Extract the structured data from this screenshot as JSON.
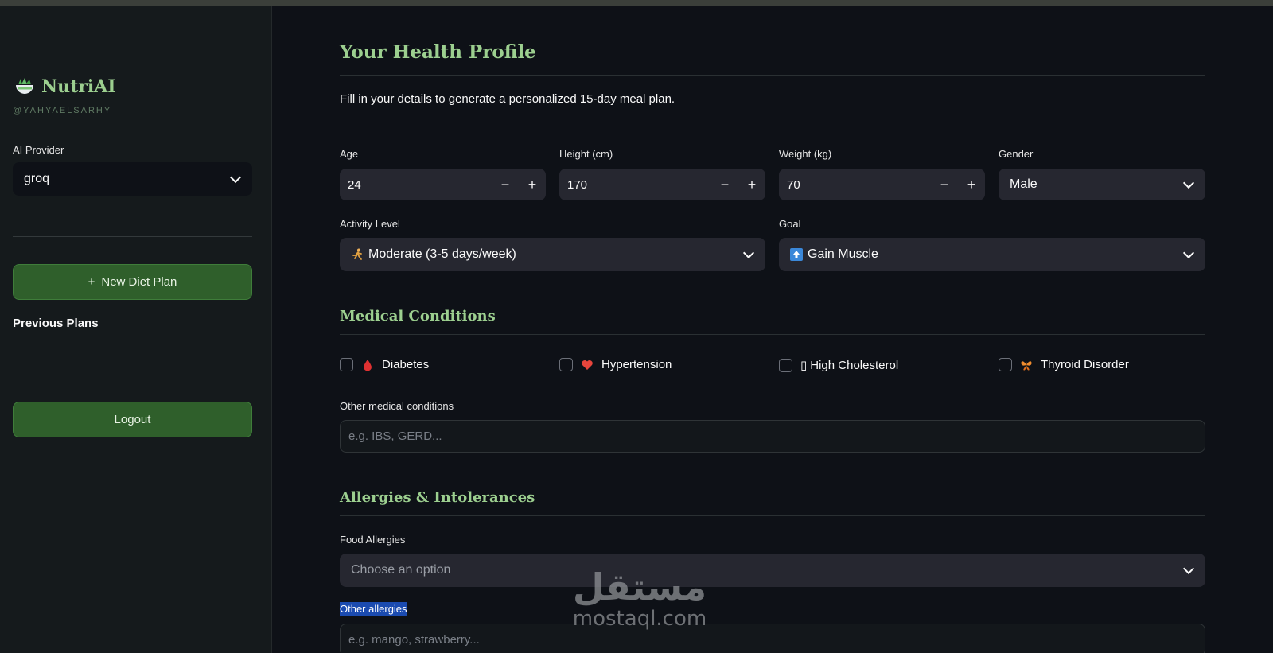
{
  "sidebar": {
    "brand": "NutriAI",
    "handle": "@YAHYAELSARHY",
    "provider_label": "AI Provider",
    "provider_value": "groq",
    "new_plan": "New Diet Plan",
    "new_plan_icon": "+",
    "previous_plans": "Previous Plans",
    "logout": "Logout"
  },
  "profile": {
    "title": "Your Health Profile",
    "intro": "Fill in your details to generate a personalized 15-day meal plan.",
    "age_label": "Age",
    "age_value": "24",
    "height_label": "Height (cm)",
    "height_value": "170",
    "weight_label": "Weight (kg)",
    "weight_value": "70",
    "gender_label": "Gender",
    "gender_value": "Male",
    "activity_label": "Activity Level",
    "activity_value": "Moderate (3-5 days/week)",
    "goal_label": "Goal",
    "goal_value": "Gain Muscle",
    "minus": "−",
    "plus": "+"
  },
  "medical": {
    "title": "Medical Conditions",
    "conditions": [
      "Diabetes",
      "Hypertension",
      "High Cholesterol",
      "Thyroid Disorder"
    ],
    "cholesterol_glyph": "▯",
    "other_label": "Other medical conditions",
    "other_placeholder": "e.g. IBS, GERD..."
  },
  "allergies": {
    "title": "Allergies & Intolerances",
    "food_label": "Food Allergies",
    "food_placeholder": "Choose an option",
    "other_label": "Other allergies",
    "other_placeholder": "e.g. mango, strawberry..."
  },
  "watermark": {
    "arabic": "مستقل",
    "latin": "mostaql.com"
  },
  "colors": {
    "accent": "#9ccf8f",
    "button": "#2f5f2b",
    "background": "#0e1117",
    "sidebar": "#151a1c",
    "selection": "#1b4bb0"
  },
  "icons": {
    "brand": "salad-bowl-icon",
    "activity": "running-person-icon",
    "goal": "up-arrow-icon",
    "diabetes": "blood-drop-icon",
    "hypertension": "heart-icon",
    "thyroid": "butterfly-icon"
  }
}
